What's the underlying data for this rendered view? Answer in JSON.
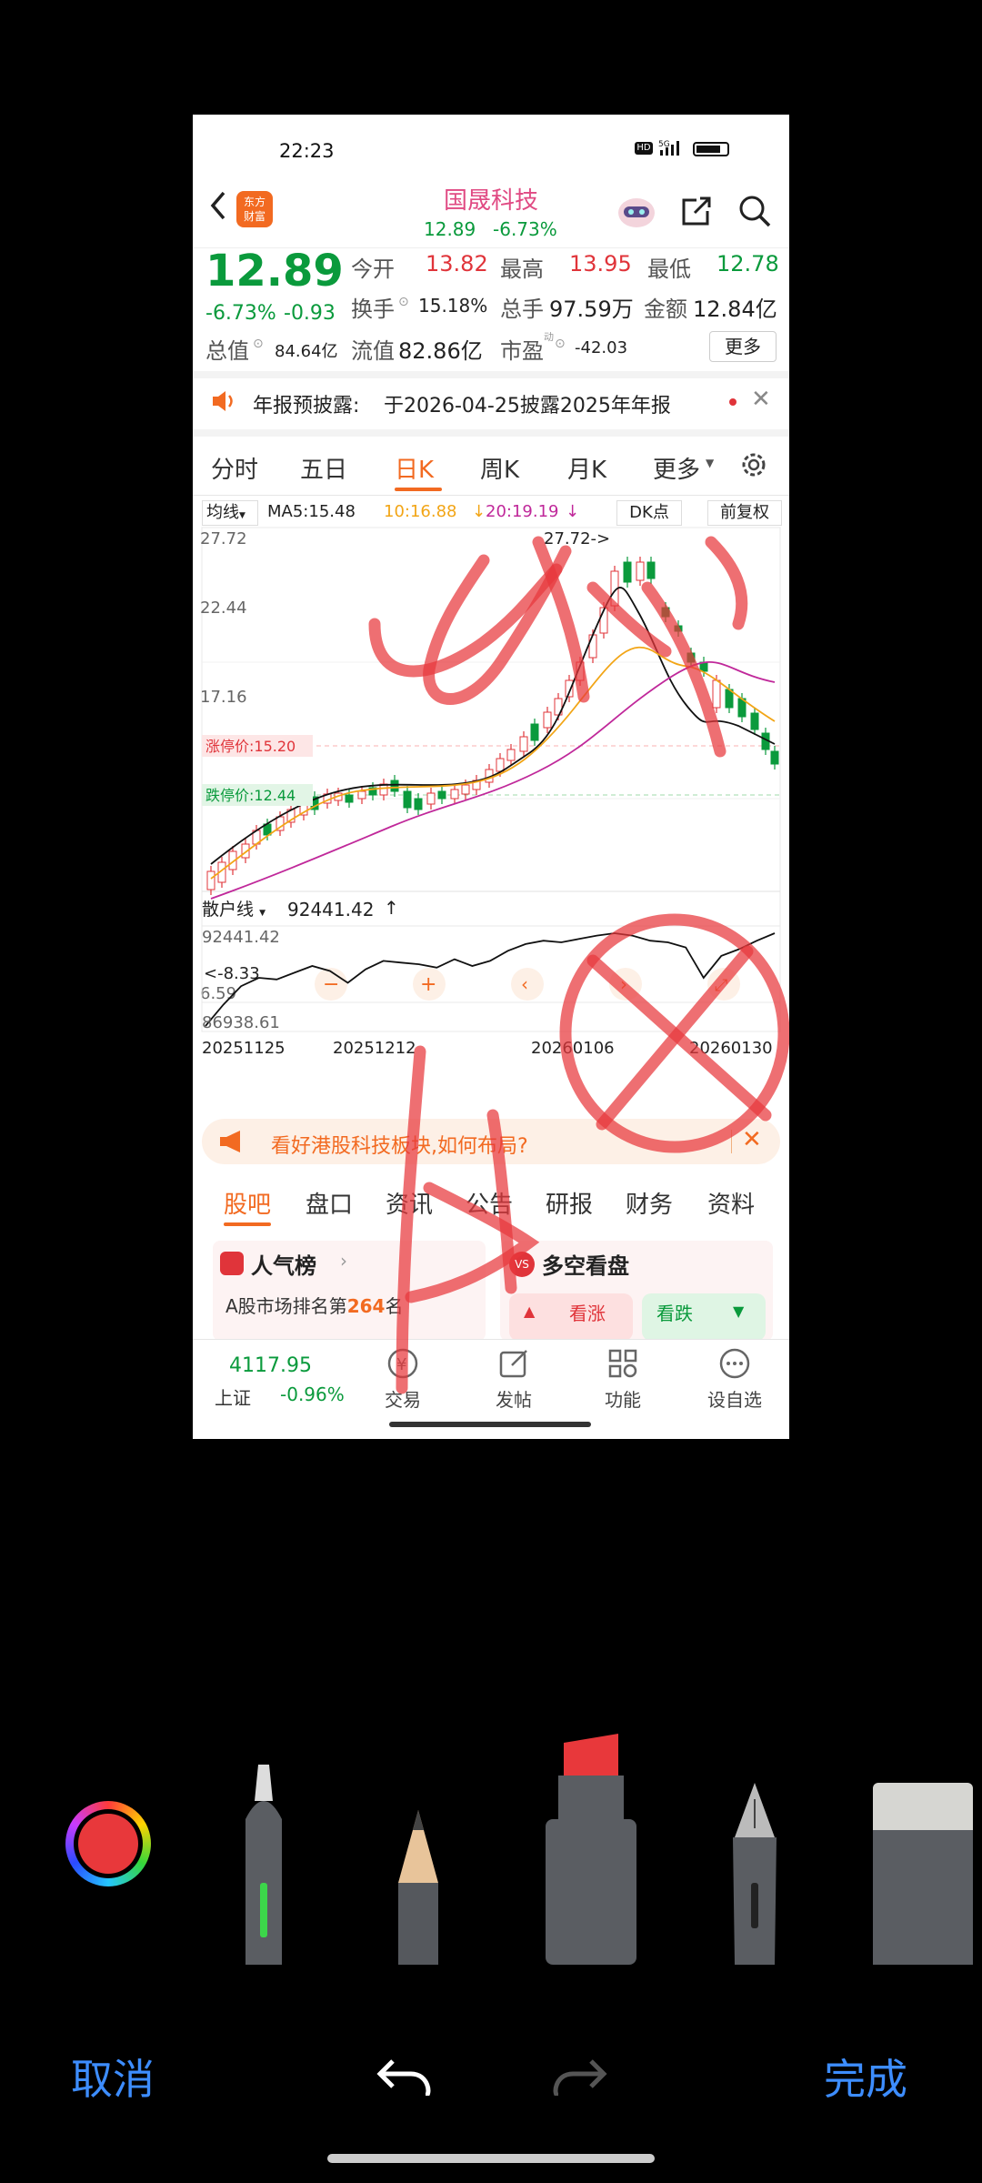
{
  "status": {
    "time": "22:23",
    "hd": "HD",
    "net": "5G"
  },
  "header": {
    "title": "国晟科技",
    "price": "12.89",
    "change": "-6.73%",
    "logo_top": "东方",
    "logo_bottom": "财富"
  },
  "quote": {
    "price": "12.89",
    "pct": "-6.73%",
    "chg": "-0.93",
    "open_label": "今开",
    "open": "13.82",
    "high_label": "最高",
    "high": "13.95",
    "low_label": "最低",
    "low": "12.78",
    "turnover_label": "换手",
    "turnover": "15.18%",
    "vol_label": "总手",
    "vol": "97.59万",
    "amt_label": "金额",
    "amt": "12.84亿",
    "mcap_label": "总值",
    "mcap": "84.64亿",
    "float_label": "流值",
    "float": "82.86亿",
    "pe_label": "市盈",
    "pe_sup": "动",
    "pe": "-42.03",
    "more": "更多"
  },
  "notice": {
    "label": "年报预披露:",
    "text": "于2026-04-25披露2025年年报"
  },
  "tabs": [
    "分时",
    "五日",
    "日K",
    "周K",
    "月K",
    "更多"
  ],
  "chart_bar": {
    "ma_btn": "均线",
    "ma5": "MA5:15.48",
    "ma10": "10:16.88",
    "ma20": "20:19.19",
    "dk": "DK点",
    "fq": "前复权"
  },
  "kline": {
    "ymax": "27.72",
    "y2": "22.44",
    "y3": "17.16",
    "ymin": "6.59",
    "limit_up": "涨停价:15.20",
    "limit_dn": "跌停价:12.44",
    "peak_label": "27.72->",
    "low_label": "<-8.33"
  },
  "indicator": {
    "name": "散户线",
    "value": "92441.42",
    "top": "92441.42",
    "bottom": "86938.61",
    "dates": [
      "20251125",
      "20251212",
      "20260106",
      "20260130"
    ]
  },
  "banner": {
    "text": "看好港股科技板块,如何布局?"
  },
  "subtabs": [
    "股吧",
    "盘口",
    "资讯",
    "公告",
    "研报",
    "财务",
    "资料"
  ],
  "cards": {
    "rank_title": "人气榜",
    "rank_text_a": "A股市场排名第",
    "rank_num": "264",
    "rank_text_b": "名",
    "vs_title": "多空看盘",
    "bull": "看涨",
    "bear": "看跌"
  },
  "bottom_nav": {
    "index_val": "4117.95",
    "index_name": "上证",
    "index_chg": "-0.96%",
    "items": [
      "交易",
      "发帖",
      "功能",
      "设自选"
    ]
  },
  "editor": {
    "cancel": "取消",
    "done": "完成",
    "pen_color": "#e8383b"
  },
  "chart_data": [
    {
      "type": "line",
      "title": "",
      "series": [
        {
          "name": "散户线",
          "values": [
            86938.61,
            88200,
            89300,
            89800,
            89700,
            90100,
            90500,
            90200,
            89500,
            90300,
            90800,
            90700,
            90600,
            90400,
            90900,
            90500,
            90800,
            91400,
            91800,
            92000,
            91900,
            92100,
            92300,
            92441,
            92300,
            92000,
            91900,
            91600,
            89800,
            91100,
            91500,
            92000,
            92441
          ]
        }
      ],
      "ylim": [
        86938.61,
        92441.42
      ],
      "x": [
        "20251125",
        "20251212",
        "20260106",
        "20260130"
      ]
    }
  ]
}
